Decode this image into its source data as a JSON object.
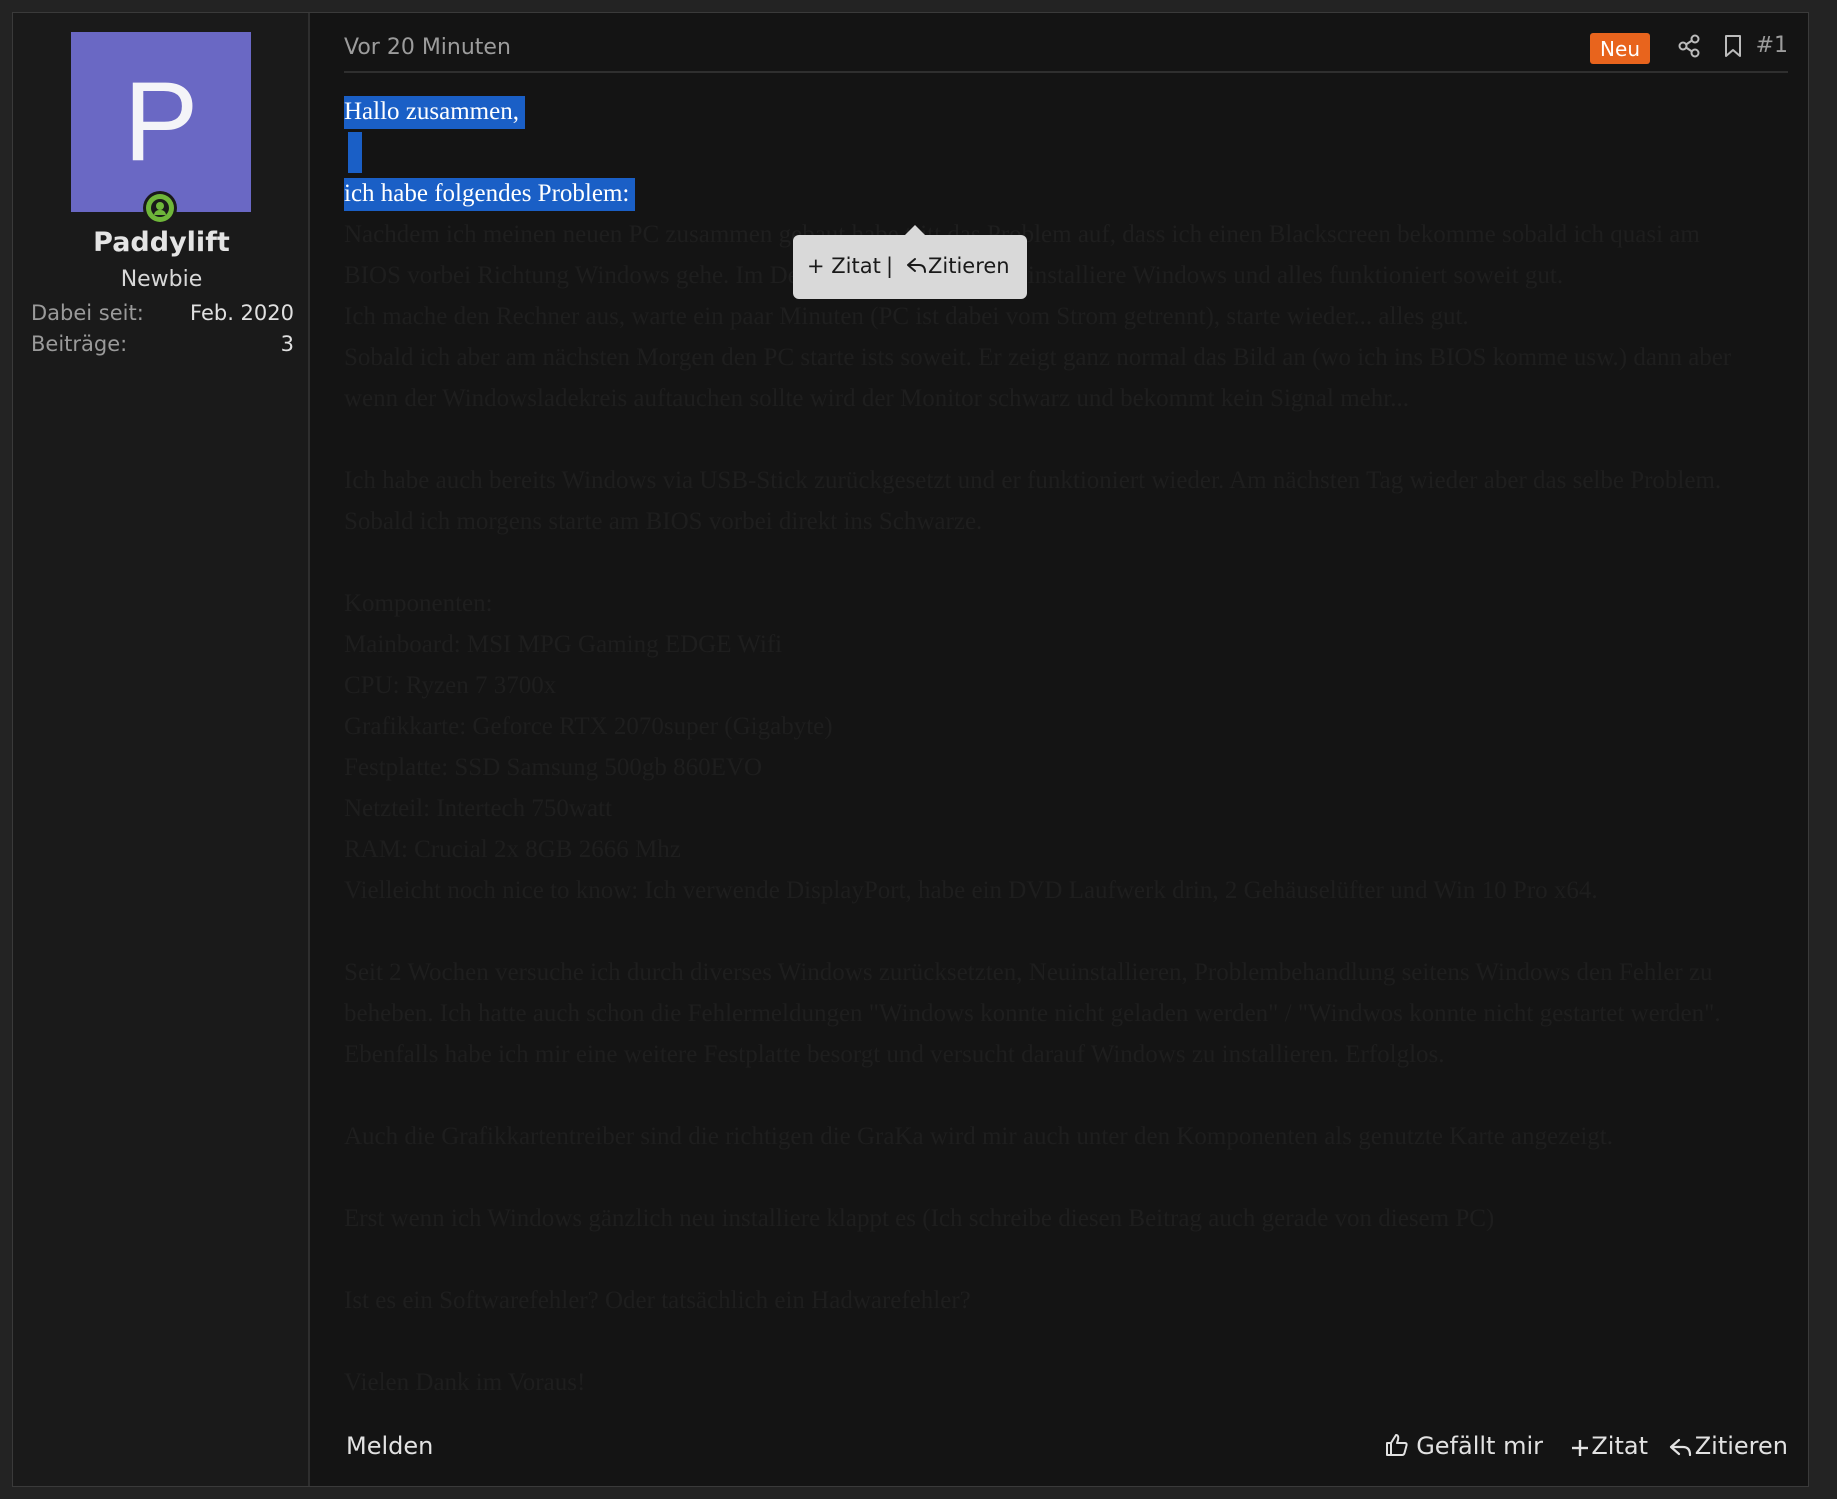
{
  "user": {
    "avatar_letter": "P",
    "username": "Paddylift",
    "title": "Newbie",
    "stats": [
      {
        "label": "Dabei seit:",
        "value": "Feb. 2020"
      },
      {
        "label": "Beiträge:",
        "value": "3"
      }
    ]
  },
  "header": {
    "time": "Vor 20 Minuten",
    "badge": "Neu",
    "post_number": "#1"
  },
  "content": {
    "selected_lines": [
      "Hallo zusammen,",
      "ich habe folgendes Problem:"
    ],
    "lines": [
      "Nachdem ich meinen neuen PC zusammen gebaut habe tritt das Problem auf, dass ich einen Blackscreen bekomme sobald ich quasi am",
      "BIOS vorbei Richtung Windows gehe. Im Detail: Ich starte den PC, installiere Windows und alles funktioniert soweit gut.",
      "Ich mache den Rechner aus, warte ein paar Minuten (PC ist dabei vom Strom getrennt), starte wieder... alles gut.",
      "Sobald ich aber am nächsten Morgen den PC starte ists soweit. Er zeigt ganz normal das Bild an (wo ich ins BIOS komme usw.) dann aber",
      "wenn der Windowsladekreis auftauchen sollte wird der Monitor schwarz und bekommt kein Signal mehr...",
      "",
      "Ich habe auch bereits Windows via USB-Stick zurückgesetzt und er funktioniert wieder. Am nächsten Tag wieder aber das selbe Problem.",
      "Sobald ich morgens starte am BIOS vorbei direkt ins Schwarze.",
      "",
      "Komponenten:",
      "Mainboard: MSI MPG Gaming EDGE Wifi",
      "CPU: Ryzen 7 3700x",
      "Grafikkarte: Geforce RTX 2070super (Gigabyte)",
      "Festplatte: SSD Samsung 500gb 860EVO",
      "Netzteil: Intertech 750watt",
      "RAM: Crucial 2x 8GB 2666 Mhz",
      "Vielleicht noch nice to know: Ich verwende DisplayPort, habe ein DVD Laufwerk drin, 2 Gehäuselüfter und Win 10 Pro x64.",
      "",
      "Seit 2 Wochen versuche ich durch diverses Windows zurücksetzten, Neuinstallieren, Problembehandlung seitens Windows den Fehler zu",
      "beheben. Ich hatte auch schon die Fehlermeldungen \"Windows konnte nicht geladen werden\" / \"Windwos konnte nicht gestartet werden\".",
      "Ebenfalls habe ich mir eine weitere Festplatte besorgt und versucht darauf Windows zu installieren. Erfolglos.",
      "",
      "Auch die Grafikkartentreiber sind die richtigen die GraKa wird mir auch unter den Komponenten als genutzte Karte angezeigt.",
      "",
      "Erst wenn ich Windows gänzlich neu installiere klappt es (Ich schreibe diesen Beitrag auch gerade von diesem PC)",
      "",
      "Ist es ein Softwarefehler? Oder tatsächlich ein Hadwarefehler?",
      "",
      "Vielen Dank im Voraus!"
    ]
  },
  "quote_popup": {
    "zitat_label": "+ Zitat",
    "separator": "|",
    "zitieren_label": "Zitieren"
  },
  "footer": {
    "report_label": "Melden",
    "like_label": "Gefällt mir",
    "quote_label": "Zitat",
    "reply_label": "Zitieren"
  },
  "colors": {
    "accent_badge": "#e8641d",
    "avatar_bg": "#6a68c4",
    "selection": "#1a5fc6",
    "online": "#6fb73a"
  },
  "icons": [
    "share-icon",
    "bookmark-icon",
    "thumbs-up-icon",
    "plus-icon",
    "reply-icon",
    "online-status-icon"
  ]
}
